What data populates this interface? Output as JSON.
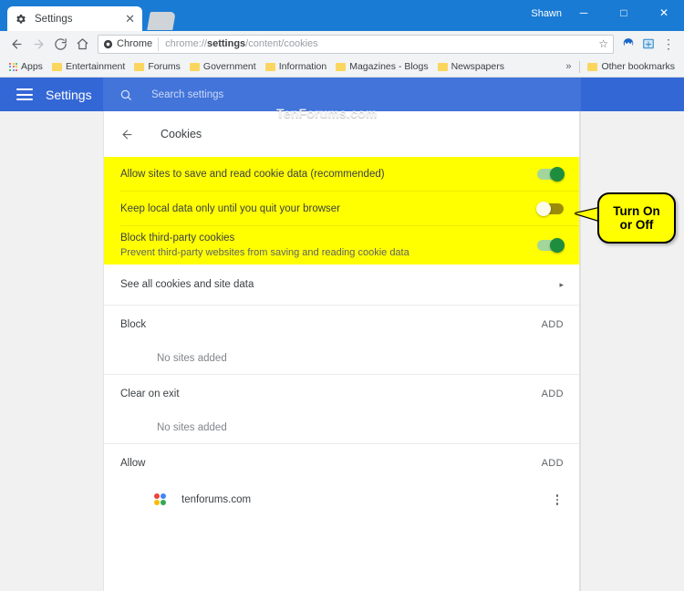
{
  "window": {
    "user": "Shawn",
    "minimize": "─",
    "maximize": "□",
    "close": "✕"
  },
  "tab": {
    "title": "Settings",
    "close": "✕",
    "favicon_icon": "gear-icon"
  },
  "toolbar": {
    "back_icon": "←",
    "forward_icon": "→",
    "reload_icon": "⟳",
    "home_icon": "⌂",
    "secure_label": "Chrome",
    "url_prefix": "chrome://",
    "url_bold": "settings",
    "url_suffix": "/content/cookies",
    "star_icon": "☆",
    "menu_icon": "⋮",
    "extension_1": "malwarebytes-icon",
    "extension_2": "grammar-extension-icon"
  },
  "bookmarks": {
    "apps_label": "Apps",
    "items": [
      {
        "label": "Entertainment"
      },
      {
        "label": "Forums"
      },
      {
        "label": "Government"
      },
      {
        "label": "Information"
      },
      {
        "label": "Magazines - Blogs"
      },
      {
        "label": "Newspapers"
      }
    ],
    "overflow": "»",
    "other_label": "Other bookmarks"
  },
  "settings_header": {
    "title": "Settings",
    "search_placeholder": "Search settings",
    "search_value": ""
  },
  "watermark": "TenForums.com",
  "page": {
    "back_icon": "←",
    "title": "Cookies",
    "toggles": [
      {
        "label": "Allow sites to save and read cookie data (recommended)",
        "sub": "",
        "state": "on",
        "highlighted": true
      },
      {
        "label": "Keep local data only until you quit your browser",
        "sub": "",
        "state": "off",
        "highlighted": true
      },
      {
        "label": "Block third-party cookies",
        "sub": "Prevent third-party websites from saving and reading cookie data",
        "state": "on",
        "highlighted": true
      }
    ],
    "see_all": {
      "label": "See all cookies and site data",
      "arrow": "▸"
    },
    "sections": [
      {
        "title": "Block",
        "add_label": "ADD",
        "empty_label": "No sites added",
        "sites": []
      },
      {
        "title": "Clear on exit",
        "add_label": "ADD",
        "empty_label": "No sites added",
        "sites": []
      },
      {
        "title": "Allow",
        "add_label": "ADD",
        "empty_label": "",
        "sites": [
          {
            "name": "tenforums.com",
            "favicon_icon": "tenforums-pinwheel-icon"
          }
        ]
      }
    ]
  },
  "callout": {
    "line1": "Turn On",
    "line2": "or Off"
  },
  "colors": {
    "title_bar": "#1a7bd4",
    "settings_blue": "#3367d6",
    "search_blue": "#4274da",
    "highlight": "#ffff00",
    "toggle_on": "#1e8e3e",
    "page_bg": "#f1f1f1"
  }
}
